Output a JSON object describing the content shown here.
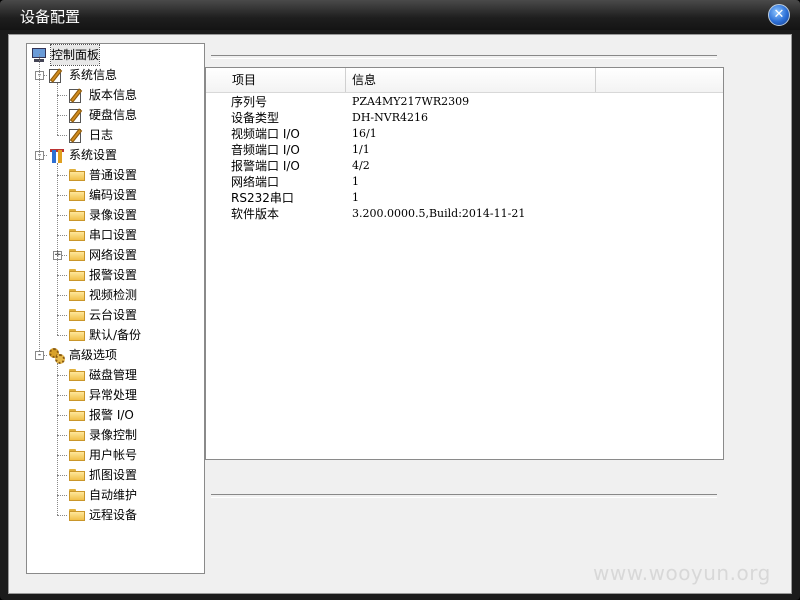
{
  "window": {
    "title": "设备配置",
    "close_glyph": "✕"
  },
  "tree": {
    "root": {
      "label": "控制面板",
      "icon": "monitor-icon"
    },
    "groups": [
      {
        "label": "系统信息",
        "icon": "edit-doc-icon",
        "children": [
          {
            "label": "版本信息",
            "icon": "edit-doc-icon"
          },
          {
            "label": "硬盘信息",
            "icon": "edit-doc-icon"
          },
          {
            "label": "日志",
            "icon": "edit-doc-icon"
          }
        ]
      },
      {
        "label": "系统设置",
        "icon": "tools-icon",
        "children": [
          {
            "label": "普通设置",
            "icon": "folder-icon"
          },
          {
            "label": "编码设置",
            "icon": "folder-icon"
          },
          {
            "label": "录像设置",
            "icon": "folder-icon"
          },
          {
            "label": "串口设置",
            "icon": "folder-icon"
          },
          {
            "label": "网络设置",
            "icon": "folder-icon",
            "expandable": true
          },
          {
            "label": "报警设置",
            "icon": "folder-icon"
          },
          {
            "label": "视频检测",
            "icon": "folder-icon"
          },
          {
            "label": "云台设置",
            "icon": "folder-icon"
          },
          {
            "label": "默认/备份",
            "icon": "folder-icon"
          }
        ]
      },
      {
        "label": "高级选项",
        "icon": "gear-icon",
        "children": [
          {
            "label": "磁盘管理",
            "icon": "folder-icon"
          },
          {
            "label": "异常处理",
            "icon": "folder-icon"
          },
          {
            "label": "报警 I/O",
            "icon": "folder-icon"
          },
          {
            "label": "录像控制",
            "icon": "folder-icon"
          },
          {
            "label": "用户帐号",
            "icon": "folder-icon"
          },
          {
            "label": "抓图设置",
            "icon": "folder-icon"
          },
          {
            "label": "自动维护",
            "icon": "folder-icon"
          },
          {
            "label": "远程设备",
            "icon": "folder-icon"
          }
        ]
      }
    ]
  },
  "info_table": {
    "columns": [
      "项目",
      "信息"
    ],
    "rows": [
      [
        "序列号",
        "PZA4MY217WR2309"
      ],
      [
        "设备类型",
        "DH-NVR4216"
      ],
      [
        "视频端口 I/O",
        "16/1"
      ],
      [
        "音频端口 I/O",
        "1/1"
      ],
      [
        "报警端口 I/O",
        "4/2"
      ],
      [
        "网络端口",
        "1"
      ],
      [
        "RS232串口",
        "1"
      ],
      [
        "软件版本",
        "3.200.0000.5,Build:2014-11-21"
      ]
    ]
  },
  "watermark": "www.wooyun.org"
}
